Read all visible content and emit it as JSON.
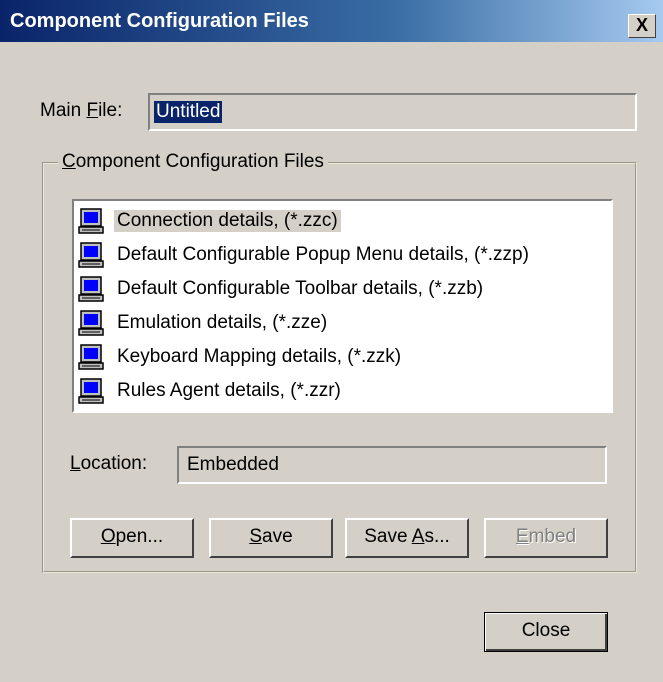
{
  "window": {
    "title": "Component Configuration Files",
    "close_glyph": "X",
    "close_icon": "close-icon"
  },
  "main_file": {
    "label_pre": "Main ",
    "label_key": "F",
    "label_post": "ile:",
    "value": "Untitled"
  },
  "group": {
    "legend_key": "C",
    "legend_rest": "omponent Configuration Files"
  },
  "files": [
    {
      "label": "Connection details, (*.zzc)",
      "icon": "computer-icon",
      "selected": true
    },
    {
      "label": "Default Configurable Popup Menu details, (*.zzp)",
      "icon": "computer-icon",
      "selected": false
    },
    {
      "label": "Default Configurable Toolbar details, (*.zzb)",
      "icon": "computer-icon",
      "selected": false
    },
    {
      "label": "Emulation details, (*.zze)",
      "icon": "computer-icon",
      "selected": false
    },
    {
      "label": "Keyboard Mapping details, (*.zzk)",
      "icon": "computer-icon",
      "selected": false
    },
    {
      "label": "Rules Agent details, (*.zzr)",
      "icon": "computer-icon",
      "selected": false
    }
  ],
  "location": {
    "label_key": "L",
    "label_rest": "ocation:",
    "value": "Embedded"
  },
  "buttons": {
    "open_key": "O",
    "open_rest": "pen...",
    "save_key": "S",
    "save_rest": "ave",
    "saveas_pre": "Save ",
    "saveas_key": "A",
    "saveas_rest": "s...",
    "embed_key": "E",
    "embed_rest": "mbed",
    "close": "Close"
  },
  "colors": {
    "titlebar_start": "#0a246a",
    "titlebar_end": "#a6caf0",
    "dialog_bg": "#d4d0c8",
    "selection": "#0a246a"
  }
}
